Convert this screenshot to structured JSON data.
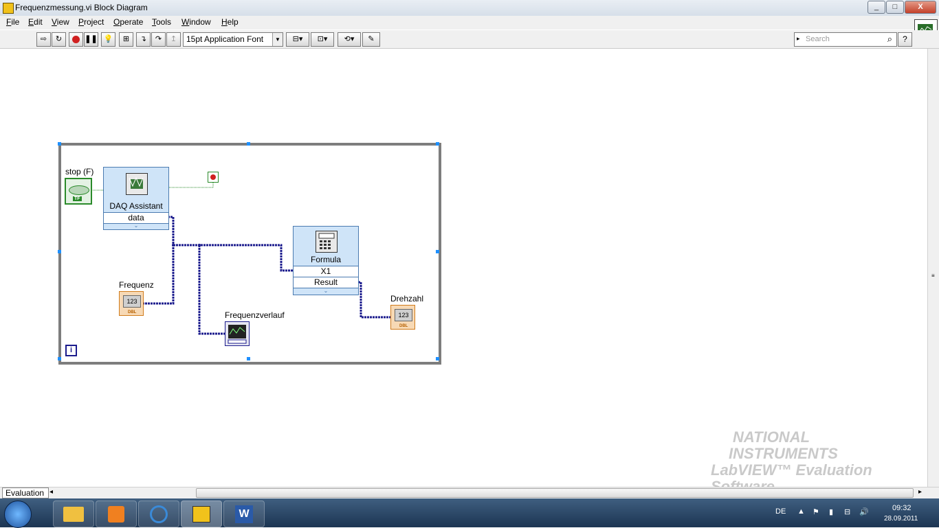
{
  "window": {
    "title": "Frequenzmessung.vi Block Diagram",
    "min": "_",
    "max": "□",
    "close": "X"
  },
  "menu": [
    "File",
    "Edit",
    "View",
    "Project",
    "Operate",
    "Tools",
    "Window",
    "Help"
  ],
  "toolbar": {
    "font": "15pt Application Font",
    "search_placeholder": "Search",
    "help": "?"
  },
  "diagram": {
    "stop_label": "stop (F)",
    "stop_tag": "TF",
    "daq_title": "DAQ Assistant",
    "daq_output": "data",
    "formula_title": "Formula",
    "formula_input": "X1",
    "formula_output": "Result",
    "frequenz_label": "Frequenz",
    "frequenzverlauf_label": "Frequenzverlauf",
    "drehzahl_label": "Drehzahl",
    "indicator_value": "123",
    "indicator_type": "DBL",
    "loop_iteration": "i"
  },
  "statusbar": {
    "context": "Evaluation"
  },
  "watermark": {
    "line1": "NATIONAL",
    "line2": "INSTRUMENTS",
    "line3": "LabVIEW™ Evaluation Software"
  },
  "tray": {
    "lang": "DE",
    "time": "09:32",
    "date": "28.09.2011"
  }
}
